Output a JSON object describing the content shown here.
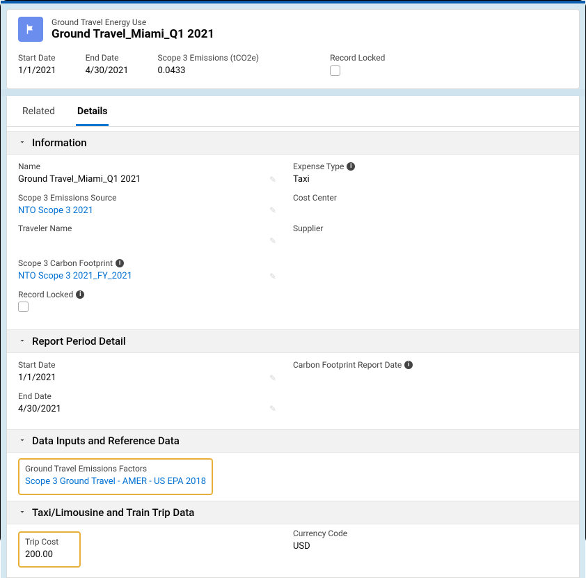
{
  "header": {
    "record_type": "Ground Travel Energy Use",
    "title": "Ground Travel_Miami_Q1 2021"
  },
  "summary": {
    "start_date_label": "Start Date",
    "start_date_value": "1/1/2021",
    "end_date_label": "End Date",
    "end_date_value": "4/30/2021",
    "scope3_label": "Scope 3 Emissions (tCO2e)",
    "scope3_value": "0.0433",
    "record_locked_label": "Record Locked"
  },
  "tabs": {
    "related": "Related",
    "details": "Details"
  },
  "sections": {
    "information": {
      "title": "Information",
      "name_label": "Name",
      "name_value": "Ground Travel_Miami_Q1 2021",
      "expense_type_label": "Expense Type",
      "expense_type_value": "Taxi",
      "source_label": "Scope 3 Emissions Source",
      "source_value": "NTO Scope 3 2021",
      "cost_center_label": "Cost Center",
      "traveler_label": "Traveler Name",
      "supplier_label": "Supplier",
      "footprint_label": "Scope 3 Carbon Footprint",
      "footprint_value": "NTO Scope 3 2021_FY_2021",
      "record_locked_label": "Record Locked"
    },
    "report_period": {
      "title": "Report Period Detail",
      "start_date_label": "Start Date",
      "start_date_value": "1/1/2021",
      "cfr_date_label": "Carbon Footprint Report Date",
      "end_date_label": "End Date",
      "end_date_value": "4/30/2021"
    },
    "data_inputs": {
      "title": "Data Inputs and Reference Data",
      "factors_label": "Ground Travel Emissions Factors",
      "factors_value": "Scope 3 Ground Travel - AMER - US EPA 2018"
    },
    "trip_data": {
      "title": "Taxi/Limousine and Train Trip Data",
      "trip_cost_label": "Trip Cost",
      "trip_cost_value": "200.00",
      "currency_label": "Currency Code",
      "currency_value": "USD"
    }
  }
}
